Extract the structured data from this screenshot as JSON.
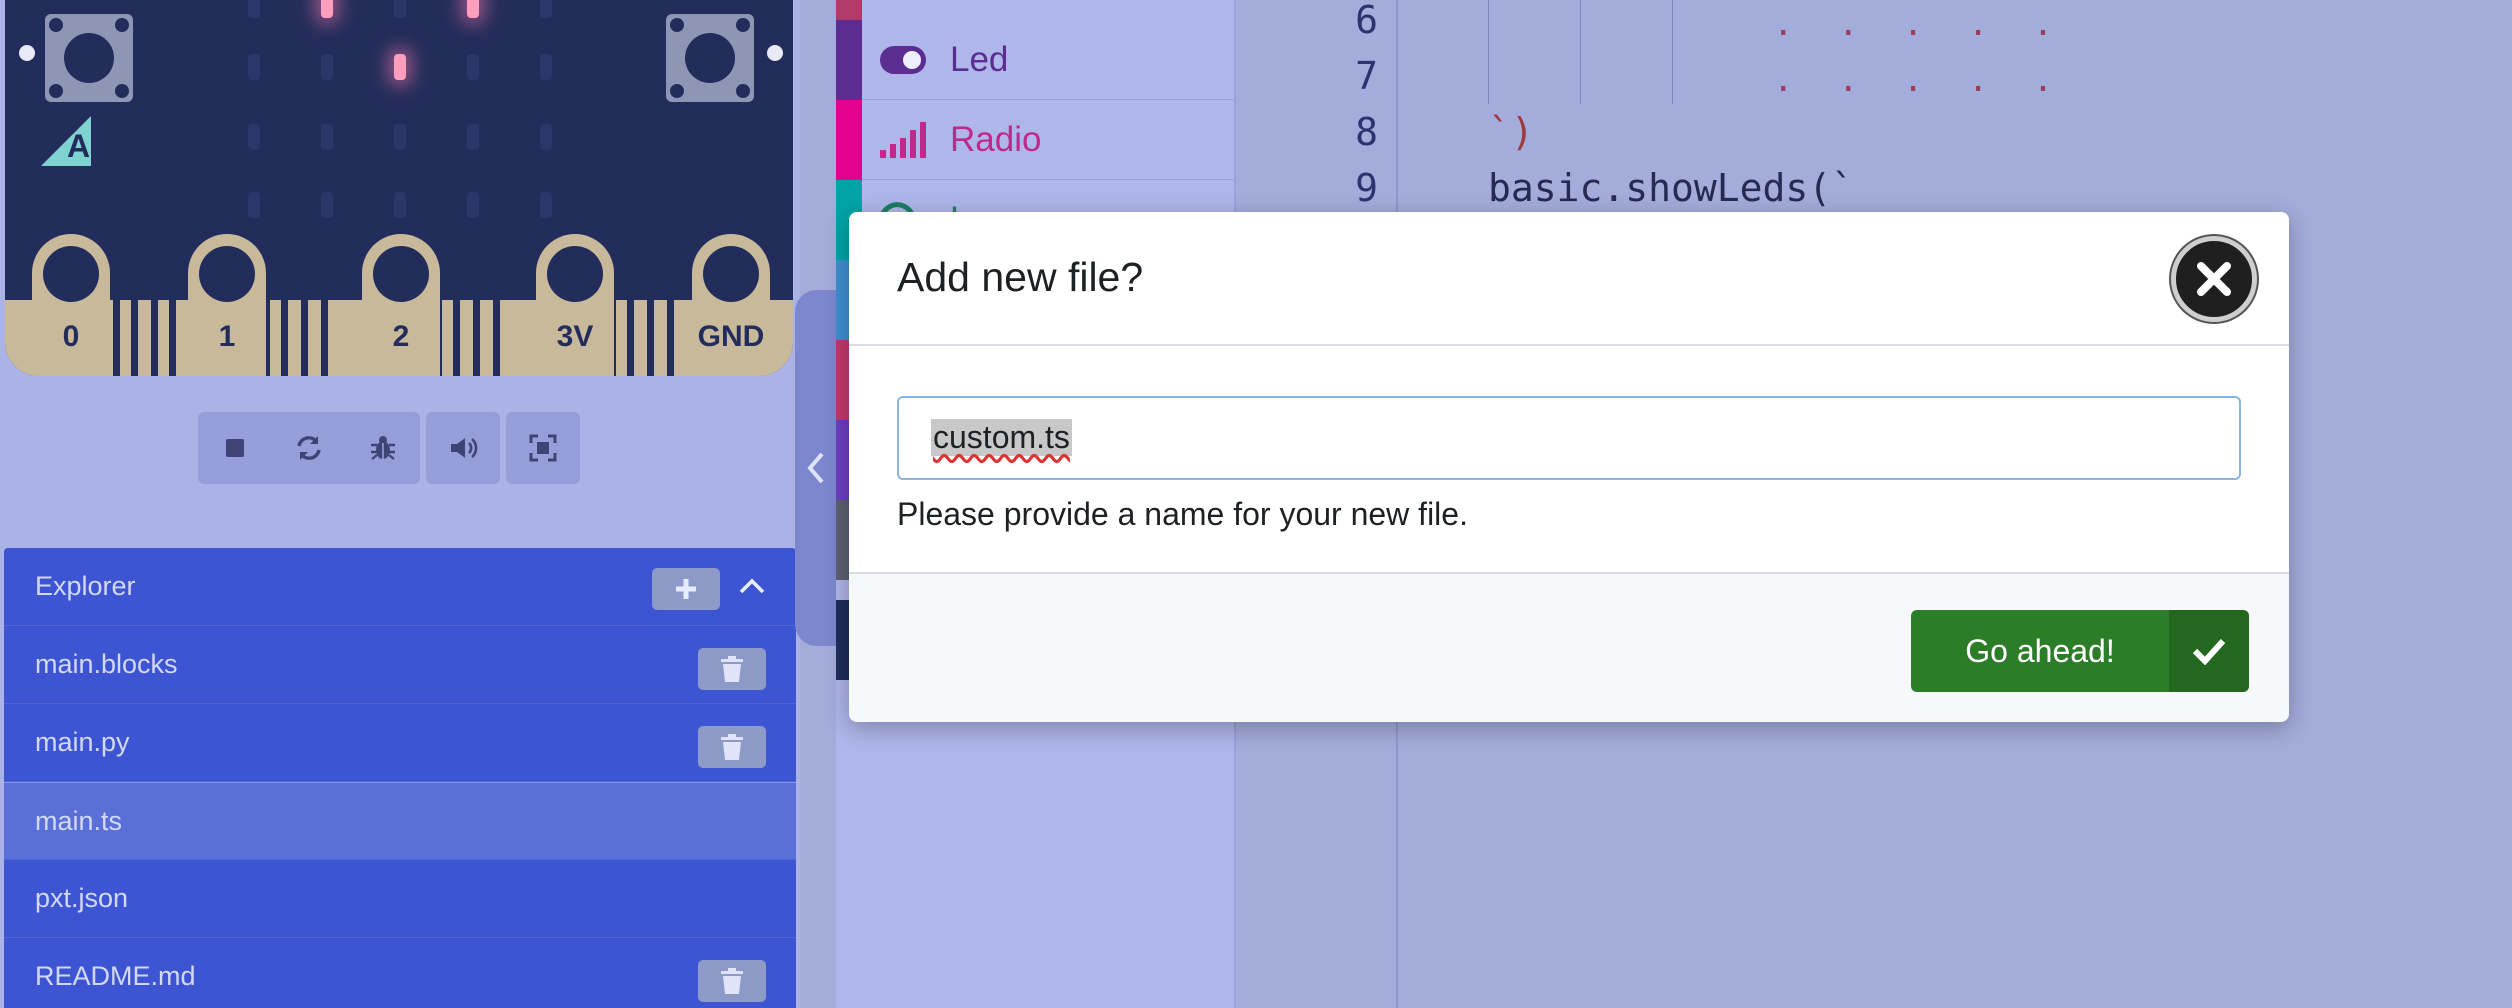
{
  "simulator": {
    "pins": [
      "0",
      "1",
      "2",
      "3V",
      "GND"
    ],
    "logo_letter": "A",
    "toolbar": [
      {
        "name": "stop-icon"
      },
      {
        "name": "restart-icon"
      },
      {
        "name": "debug-icon"
      },
      {
        "name": "mute-icon"
      },
      {
        "name": "fullscreen-icon"
      }
    ]
  },
  "explorer": {
    "title": "Explorer",
    "files": [
      {
        "label": "main.blocks",
        "deletable": true
      },
      {
        "label": "main.py",
        "deletable": true
      },
      {
        "label": "main.ts",
        "deletable": false,
        "active": true
      },
      {
        "label": "pxt.json",
        "deletable": false
      },
      {
        "label": "README.md",
        "deletable": true
      }
    ]
  },
  "toolbox": {
    "categories": [
      {
        "label": "Led",
        "color": "#5c2d91",
        "icon": "toggle-icon"
      },
      {
        "label": "Radio",
        "color": "#e3008c",
        "icon": "signal-icon"
      },
      {
        "label": "L",
        "color": "#00a4a6",
        "icon": "loops-icon"
      }
    ]
  },
  "editor": {
    "lines": [
      {
        "num": "6",
        "code": ""
      },
      {
        "num": "7",
        "code": ""
      },
      {
        "num": "8",
        "code": "`)"
      },
      {
        "num": "9",
        "code": "basic.showLeds(`"
      }
    ],
    "led_row_dots": ". . . . ."
  },
  "modal": {
    "title": "Add new file?",
    "input_value": "custom.ts",
    "hint": "Please provide a name for your new file.",
    "confirm_label": "Go ahead!"
  },
  "colors": {
    "confirm": "#2b7d27",
    "explorer": "#3d55d2",
    "board": "#232d5c"
  }
}
